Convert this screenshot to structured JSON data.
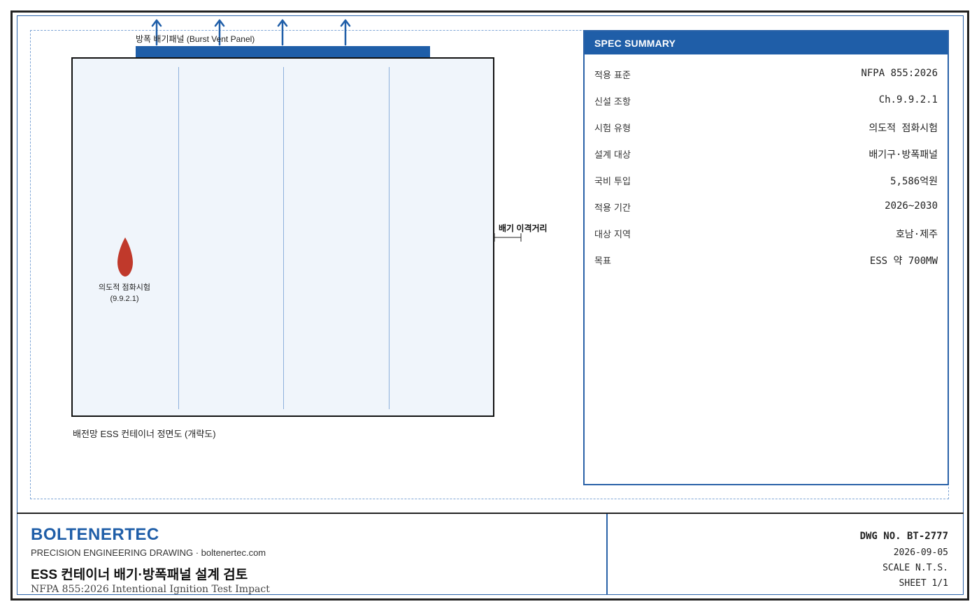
{
  "diagram": {
    "vent_panel_label": "방폭 배기패널 (Burst Vent Panel)",
    "ignition_label_line1": "의도적 점화시험",
    "ignition_label_line2": "(9.9.2.1)",
    "distance_label": "배기 이격거리",
    "caption": "배전망 ESS 컨테이너 정면도 (개략도)",
    "colors": {
      "accent": "#1f5ea8",
      "flame": "#c0392b",
      "container_fill": "#f0f5fb"
    }
  },
  "spec_summary": {
    "title": "SPEC SUMMARY",
    "rows": [
      {
        "key": "적용 표준",
        "value": "NFPA 855:2026"
      },
      {
        "key": "신설 조항",
        "value": "Ch.9.9.2.1"
      },
      {
        "key": "시험 유형",
        "value": "의도적 점화시험"
      },
      {
        "key": "설계 대상",
        "value": "배기구·방폭패널"
      },
      {
        "key": "국비 투입",
        "value": "5,586억원"
      },
      {
        "key": "적용 기간",
        "value": "2026~2030"
      },
      {
        "key": "대상 지역",
        "value": "호남·제주"
      },
      {
        "key": "목표",
        "value": "ESS 약 700MW"
      }
    ]
  },
  "title_block": {
    "brand": "BOLTENERTEC",
    "tagline": "PRECISION ENGINEERING DRAWING · boltenertec.com",
    "title": "ESS 컨테이너 배기·방폭패널 설계 검토",
    "subtitle": "NFPA 855:2026 Intentional Ignition Test Impact",
    "dwg_no": "DWG NO. BT-2777",
    "date": "2026-09-05",
    "scale": "SCALE N.T.S.",
    "sheet": "SHEET 1/1"
  }
}
